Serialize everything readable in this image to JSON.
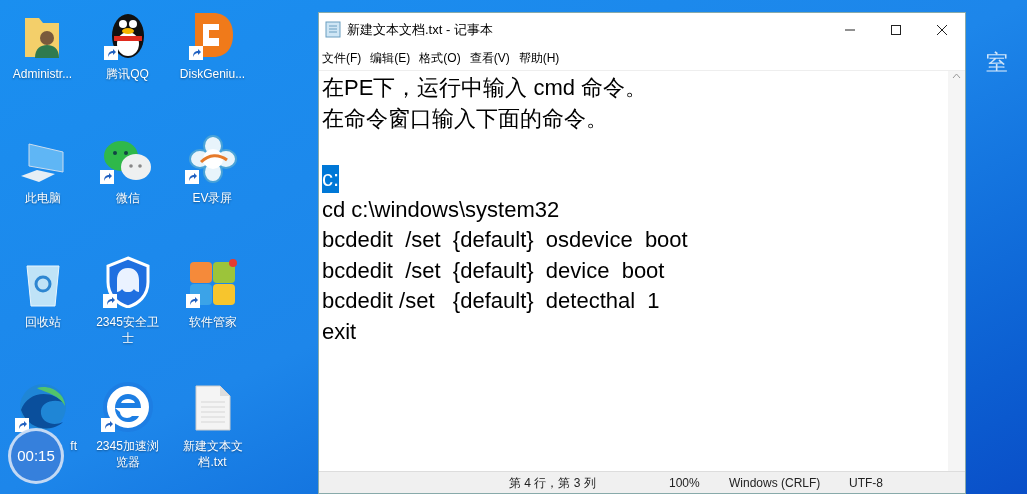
{
  "desktop": {
    "icons": [
      {
        "label": "Administr...",
        "kind": "user-folder",
        "shortcut": false
      },
      {
        "label": "腾讯QQ",
        "kind": "penguin",
        "shortcut": true
      },
      {
        "label": "DiskGeniu...",
        "kind": "disk-tool",
        "shortcut": true
      },
      {
        "label": "此电脑",
        "kind": "computer",
        "shortcut": false
      },
      {
        "label": "微信",
        "kind": "chat",
        "shortcut": true
      },
      {
        "label": "EV录屏",
        "kind": "flower",
        "shortcut": true
      },
      {
        "label": "回收站",
        "kind": "recycle-bin",
        "shortcut": false
      },
      {
        "label": "2345安全卫士",
        "kind": "shield",
        "shortcut": true
      },
      {
        "label": "软件管家",
        "kind": "tiles",
        "shortcut": true
      },
      {
        "label": "ft",
        "kind": "wave",
        "shortcut": true
      },
      {
        "label": "2345加速浏览器",
        "kind": "browser-e",
        "shortcut": true
      },
      {
        "label": "新建文本文档.txt",
        "kind": "text-file",
        "shortcut": false
      }
    ],
    "wallpaper_text": "室",
    "timer": "00:15"
  },
  "notepad": {
    "title": "新建文本文档.txt - 记事本",
    "menu": [
      "文件(F)",
      "编辑(E)",
      "格式(O)",
      "查看(V)",
      "帮助(H)"
    ],
    "paragraphs": [
      [
        {
          "text": "在PE下，运行中输入 cmd 命令。",
          "selected": false
        },
        {
          "text": "在命令窗口输入下面的命令。",
          "selected": false
        }
      ],
      [
        {
          "text": "c:",
          "selected": true
        },
        {
          "text": "cd c:\\windows\\system32",
          "selected": false
        },
        {
          "text": "bcdedit  /set  {default}  osdevice  boot",
          "selected": false
        },
        {
          "text": "bcdedit  /set  {default}  device  boot",
          "selected": false
        },
        {
          "text": "bcdedit /set   {default}  detecthal  1",
          "selected": false
        },
        {
          "text": "exit",
          "selected": false
        }
      ]
    ],
    "status_bar": [
      "第 4 行，第 3 列",
      "100%",
      "Windows (CRLF)",
      "UTF-8"
    ]
  }
}
